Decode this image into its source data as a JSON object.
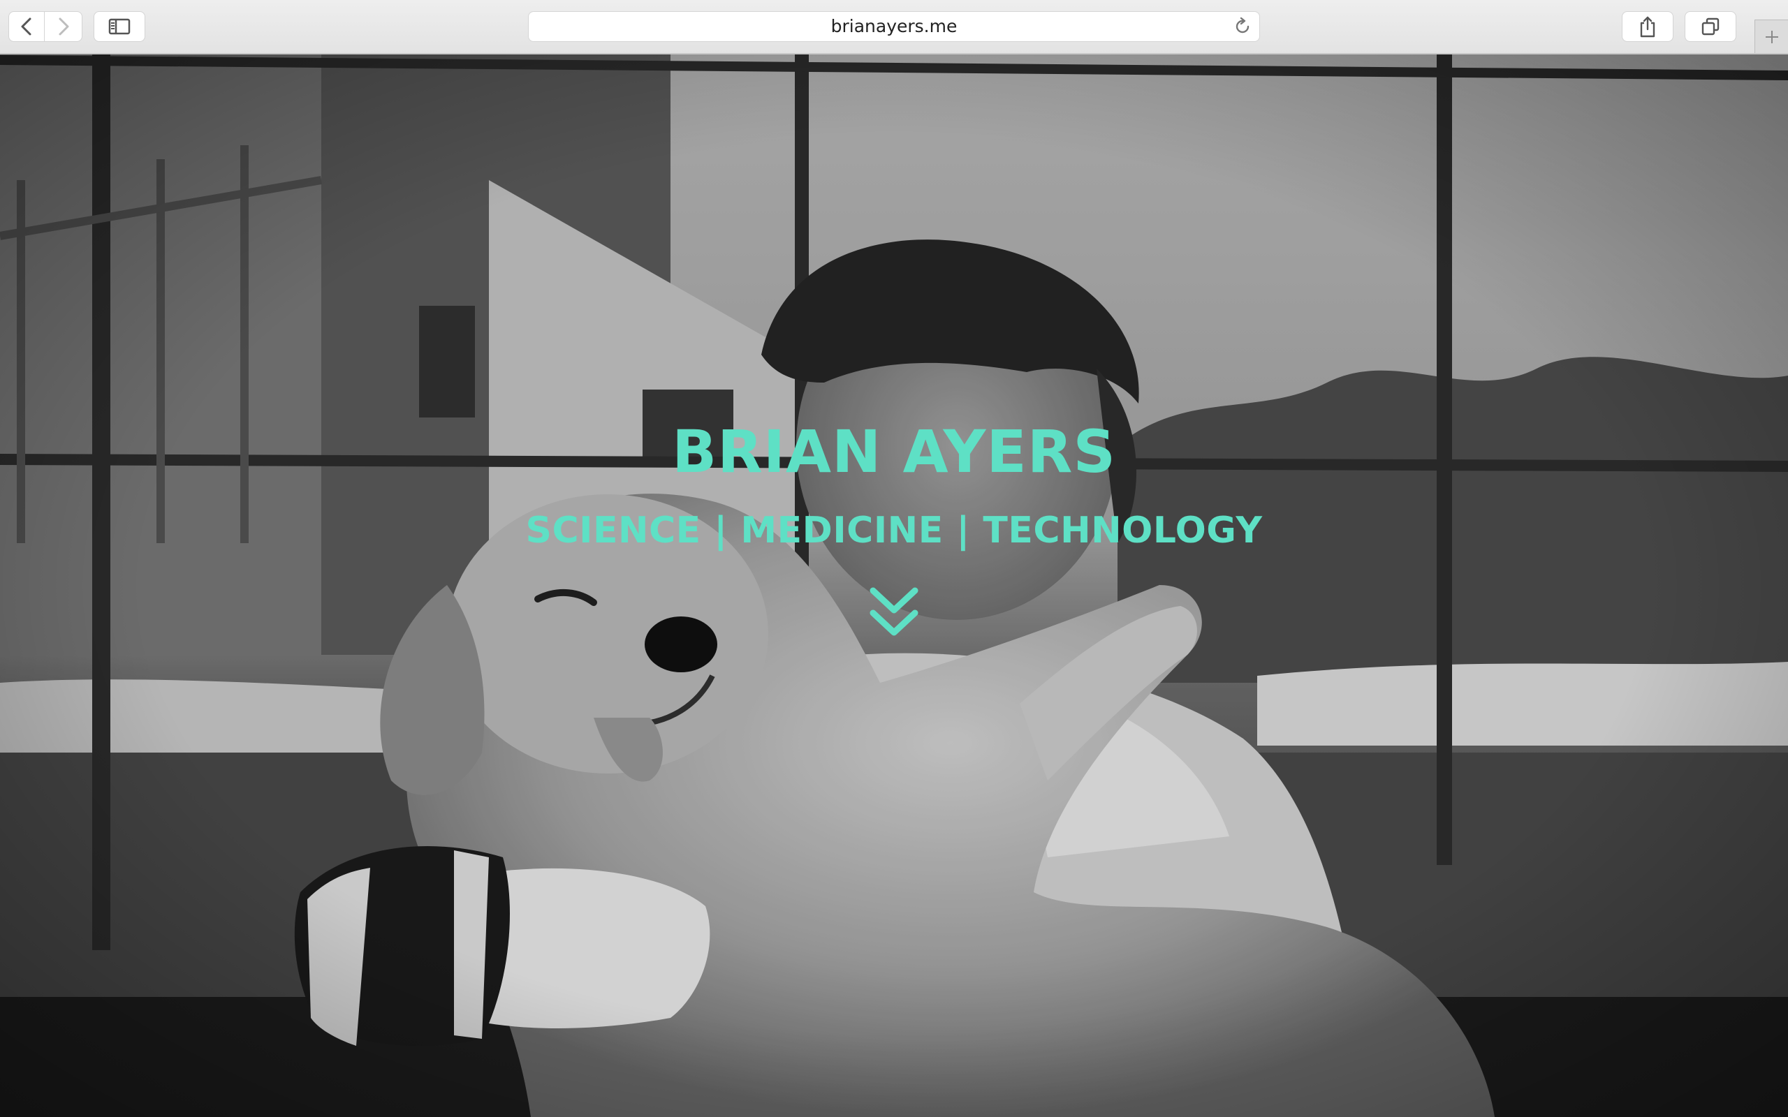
{
  "browser": {
    "url": "brianayers.me",
    "icons": {
      "back": "chevron-left-icon",
      "forward": "chevron-right-icon",
      "sidebar": "sidebar-icon",
      "reload": "reload-icon",
      "share": "share-icon",
      "tabs": "tabs-overview-icon",
      "new_tab": "plus-icon"
    }
  },
  "hero": {
    "title": "BRIAN AYERS",
    "subtitle": "SCIENCE | MEDICINE | TECHNOLOGY",
    "scroll_icon": "double-chevron-down-icon",
    "accent_color": "#5ee0c5"
  }
}
